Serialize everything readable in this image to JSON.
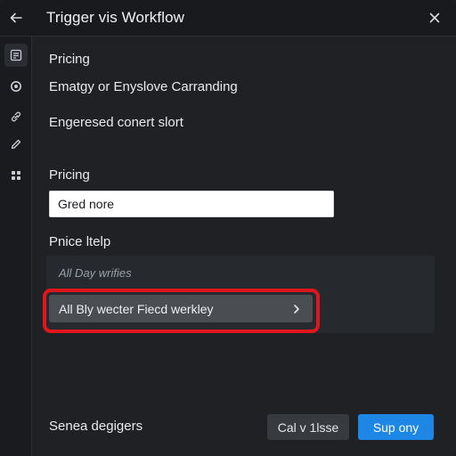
{
  "window": {
    "title": "Trigger vis Workflow"
  },
  "icons": {
    "back": "arrow-left-icon",
    "close": "close-icon",
    "sidebar": [
      "form-icon",
      "circle-icon",
      "link-icon",
      "edit-icon",
      "settings-icon"
    ]
  },
  "content": {
    "section1_heading": "Pricing",
    "line1": "Ematgy or Enyslove Carranding",
    "line2": "Engeresed conert slort",
    "section2_heading": "Pricing",
    "input_value": "Gred nore",
    "price_label": "Pnice ltelp",
    "panel_hint": "All Day wrifies",
    "option_label": "All Bly wecter Fiecd werkley"
  },
  "footer": {
    "label": "Senea degigers",
    "secondary_button": "Cal v 1lsse",
    "primary_button": "Sup ony"
  },
  "colors": {
    "background": "#1f2125",
    "highlight": "#e0161c",
    "primary": "#1e86e4"
  }
}
